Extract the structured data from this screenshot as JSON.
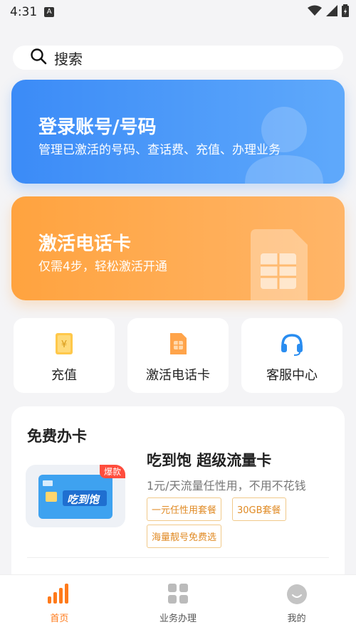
{
  "status_bar": {
    "time": "4:31",
    "a_icon": "A"
  },
  "search": {
    "label": "搜索"
  },
  "banners": {
    "login": {
      "title": "登录账号/号码",
      "subtitle": "管理已激活的号码、查话费、充值、办理业务"
    },
    "activate": {
      "title": "激活电话卡",
      "subtitle": "仅需4步，轻松激活开通"
    }
  },
  "quick_actions": [
    {
      "label": "充值"
    },
    {
      "label": "激活电话卡"
    },
    {
      "label": "客服中心"
    }
  ],
  "free_card": {
    "title": "免费办卡",
    "badge": "爆款",
    "product_title": "吃到饱 超级流量卡",
    "product_desc": "1元/天流量任性用，不用不花钱",
    "tags": [
      "一元任性用套餐",
      "30GB套餐",
      "海量靓号免费选"
    ],
    "sim_text": "吃到饱"
  },
  "tabbar": {
    "items": [
      {
        "label": "首页"
      },
      {
        "label": "业务办理"
      },
      {
        "label": "我的"
      }
    ]
  },
  "colors": {
    "accent": "#ff7a1a",
    "blue": "#3b8bf7",
    "orange": "#ffa33f"
  }
}
